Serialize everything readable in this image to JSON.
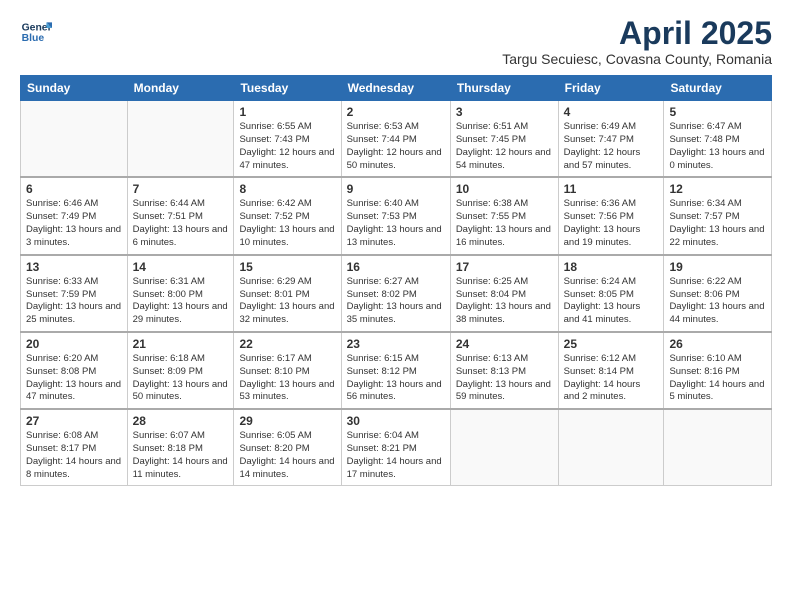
{
  "logo": {
    "line1": "General",
    "line2": "Blue"
  },
  "title": "April 2025",
  "subtitle": "Targu Secuiesc, Covasna County, Romania",
  "days_header": [
    "Sunday",
    "Monday",
    "Tuesday",
    "Wednesday",
    "Thursday",
    "Friday",
    "Saturday"
  ],
  "weeks": [
    [
      {
        "num": "",
        "info": ""
      },
      {
        "num": "",
        "info": ""
      },
      {
        "num": "1",
        "info": "Sunrise: 6:55 AM\nSunset: 7:43 PM\nDaylight: 12 hours and 47 minutes."
      },
      {
        "num": "2",
        "info": "Sunrise: 6:53 AM\nSunset: 7:44 PM\nDaylight: 12 hours and 50 minutes."
      },
      {
        "num": "3",
        "info": "Sunrise: 6:51 AM\nSunset: 7:45 PM\nDaylight: 12 hours and 54 minutes."
      },
      {
        "num": "4",
        "info": "Sunrise: 6:49 AM\nSunset: 7:47 PM\nDaylight: 12 hours and 57 minutes."
      },
      {
        "num": "5",
        "info": "Sunrise: 6:47 AM\nSunset: 7:48 PM\nDaylight: 13 hours and 0 minutes."
      }
    ],
    [
      {
        "num": "6",
        "info": "Sunrise: 6:46 AM\nSunset: 7:49 PM\nDaylight: 13 hours and 3 minutes."
      },
      {
        "num": "7",
        "info": "Sunrise: 6:44 AM\nSunset: 7:51 PM\nDaylight: 13 hours and 6 minutes."
      },
      {
        "num": "8",
        "info": "Sunrise: 6:42 AM\nSunset: 7:52 PM\nDaylight: 13 hours and 10 minutes."
      },
      {
        "num": "9",
        "info": "Sunrise: 6:40 AM\nSunset: 7:53 PM\nDaylight: 13 hours and 13 minutes."
      },
      {
        "num": "10",
        "info": "Sunrise: 6:38 AM\nSunset: 7:55 PM\nDaylight: 13 hours and 16 minutes."
      },
      {
        "num": "11",
        "info": "Sunrise: 6:36 AM\nSunset: 7:56 PM\nDaylight: 13 hours and 19 minutes."
      },
      {
        "num": "12",
        "info": "Sunrise: 6:34 AM\nSunset: 7:57 PM\nDaylight: 13 hours and 22 minutes."
      }
    ],
    [
      {
        "num": "13",
        "info": "Sunrise: 6:33 AM\nSunset: 7:59 PM\nDaylight: 13 hours and 25 minutes."
      },
      {
        "num": "14",
        "info": "Sunrise: 6:31 AM\nSunset: 8:00 PM\nDaylight: 13 hours and 29 minutes."
      },
      {
        "num": "15",
        "info": "Sunrise: 6:29 AM\nSunset: 8:01 PM\nDaylight: 13 hours and 32 minutes."
      },
      {
        "num": "16",
        "info": "Sunrise: 6:27 AM\nSunset: 8:02 PM\nDaylight: 13 hours and 35 minutes."
      },
      {
        "num": "17",
        "info": "Sunrise: 6:25 AM\nSunset: 8:04 PM\nDaylight: 13 hours and 38 minutes."
      },
      {
        "num": "18",
        "info": "Sunrise: 6:24 AM\nSunset: 8:05 PM\nDaylight: 13 hours and 41 minutes."
      },
      {
        "num": "19",
        "info": "Sunrise: 6:22 AM\nSunset: 8:06 PM\nDaylight: 13 hours and 44 minutes."
      }
    ],
    [
      {
        "num": "20",
        "info": "Sunrise: 6:20 AM\nSunset: 8:08 PM\nDaylight: 13 hours and 47 minutes."
      },
      {
        "num": "21",
        "info": "Sunrise: 6:18 AM\nSunset: 8:09 PM\nDaylight: 13 hours and 50 minutes."
      },
      {
        "num": "22",
        "info": "Sunrise: 6:17 AM\nSunset: 8:10 PM\nDaylight: 13 hours and 53 minutes."
      },
      {
        "num": "23",
        "info": "Sunrise: 6:15 AM\nSunset: 8:12 PM\nDaylight: 13 hours and 56 minutes."
      },
      {
        "num": "24",
        "info": "Sunrise: 6:13 AM\nSunset: 8:13 PM\nDaylight: 13 hours and 59 minutes."
      },
      {
        "num": "25",
        "info": "Sunrise: 6:12 AM\nSunset: 8:14 PM\nDaylight: 14 hours and 2 minutes."
      },
      {
        "num": "26",
        "info": "Sunrise: 6:10 AM\nSunset: 8:16 PM\nDaylight: 14 hours and 5 minutes."
      }
    ],
    [
      {
        "num": "27",
        "info": "Sunrise: 6:08 AM\nSunset: 8:17 PM\nDaylight: 14 hours and 8 minutes."
      },
      {
        "num": "28",
        "info": "Sunrise: 6:07 AM\nSunset: 8:18 PM\nDaylight: 14 hours and 11 minutes."
      },
      {
        "num": "29",
        "info": "Sunrise: 6:05 AM\nSunset: 8:20 PM\nDaylight: 14 hours and 14 minutes."
      },
      {
        "num": "30",
        "info": "Sunrise: 6:04 AM\nSunset: 8:21 PM\nDaylight: 14 hours and 17 minutes."
      },
      {
        "num": "",
        "info": ""
      },
      {
        "num": "",
        "info": ""
      },
      {
        "num": "",
        "info": ""
      }
    ]
  ]
}
